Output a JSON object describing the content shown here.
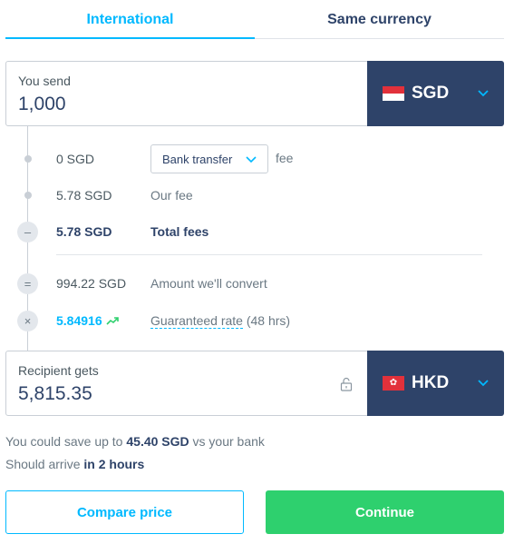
{
  "tabs": {
    "international": "International",
    "same_currency": "Same currency"
  },
  "send": {
    "label": "You send",
    "amount": "1,000",
    "currency": "SGD",
    "flag_icon": "singapore-flag-icon"
  },
  "breakdown": {
    "fee_amount": "0 SGD",
    "fee_method": "Bank transfer",
    "fee_word": "fee",
    "our_fee_amount": "5.78 SGD",
    "our_fee_label": "Our fee",
    "total_fees_amount": "5.78 SGD",
    "total_fees_label": "Total fees",
    "minus_symbol": "–",
    "convert_amount": "994.22 SGD",
    "convert_label": "Amount we'll convert",
    "equals_symbol": "=",
    "rate_value": "5.84916",
    "rate_label": "Guaranteed rate",
    "rate_duration": " (48 hrs)",
    "times_symbol": "×"
  },
  "receive": {
    "label": "Recipient gets",
    "amount": "5,815.35",
    "currency": "HKD",
    "flag_icon": "hong-kong-flag-icon"
  },
  "summary": {
    "save_prefix": "You could save up to ",
    "save_amount": "45.40 SGD",
    "save_suffix": " vs your bank",
    "arrive_prefix": "Should arrive ",
    "arrive_time": "in 2 hours"
  },
  "buttons": {
    "compare": "Compare price",
    "continue": "Continue"
  },
  "colors": {
    "accent": "#00b9ff",
    "navy": "#2e4369",
    "success": "#2ed06e"
  }
}
